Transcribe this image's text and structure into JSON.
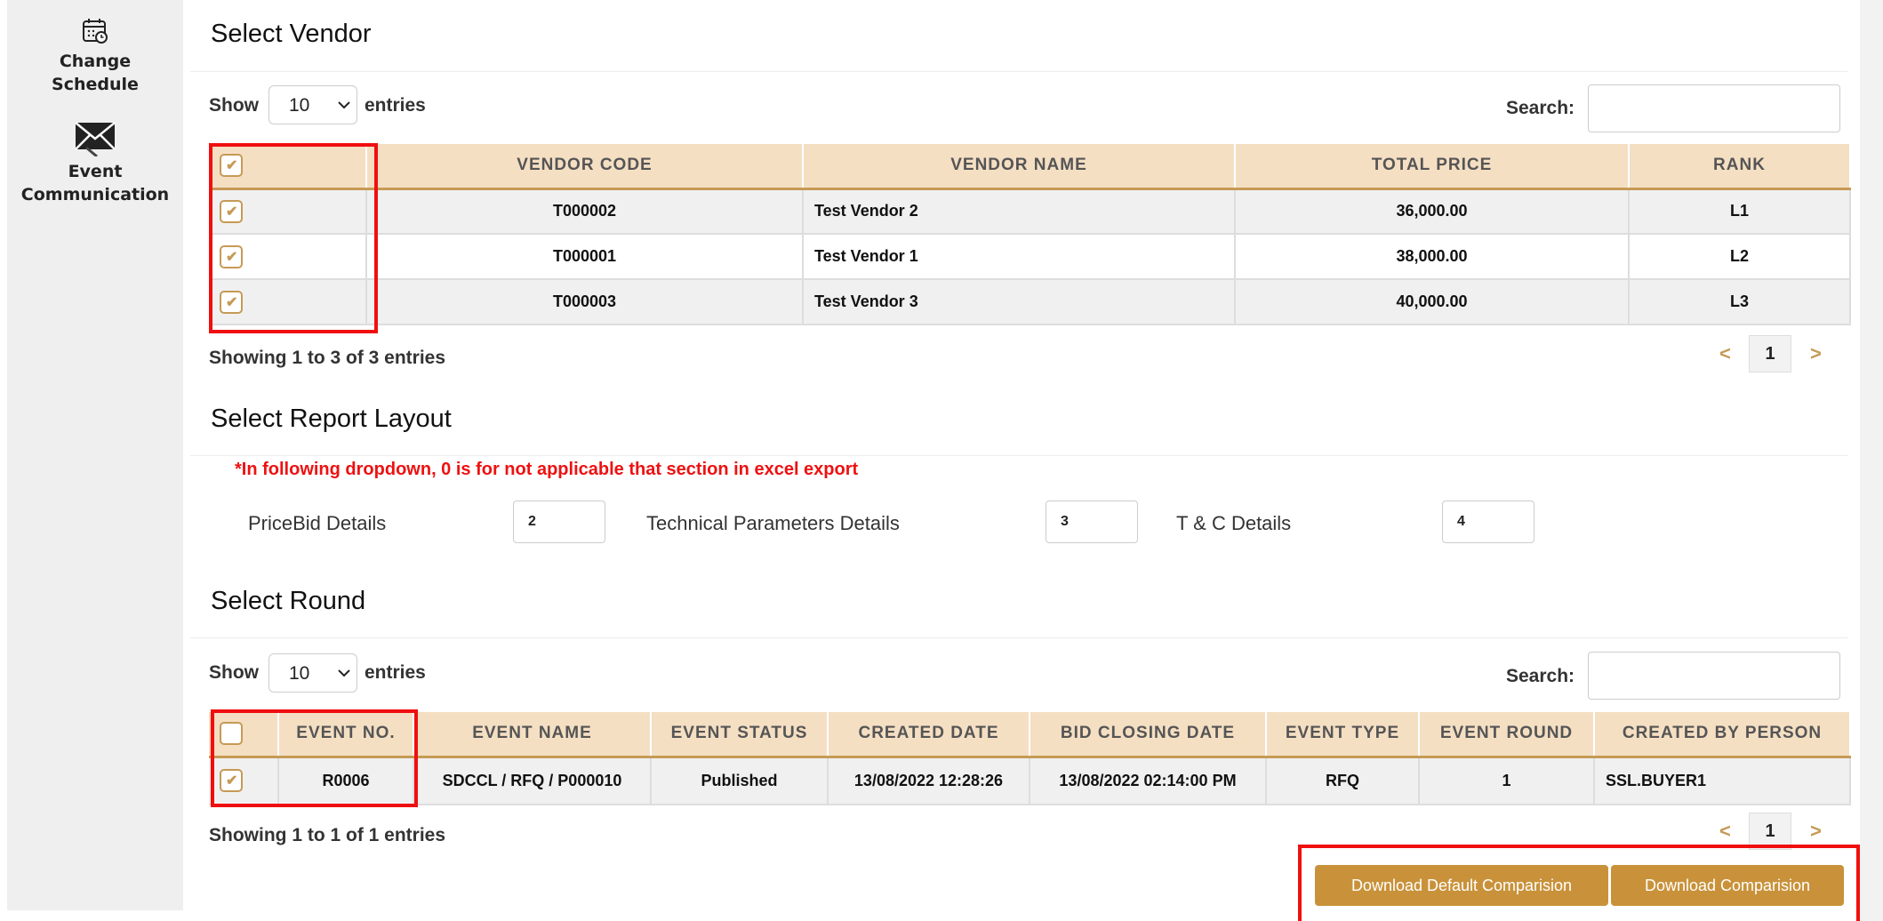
{
  "sidebar": {
    "items": [
      {
        "label": "Change Schedule",
        "icon": "calendar-clock-icon"
      },
      {
        "label": "Event Communication",
        "icon": "envelope-icon"
      }
    ]
  },
  "vendor": {
    "title": "Select Vendor",
    "show_label": "Show",
    "entries_value": "10",
    "entries_label": "entries",
    "search_label": "Search:",
    "search_value": "",
    "columns": [
      "VENDOR CODE",
      "VENDOR NAME",
      "TOTAL PRICE",
      "RANK"
    ],
    "header_checked": true,
    "rows": [
      {
        "code": "T000002",
        "name": "Test Vendor 2",
        "price": "36,000.00",
        "rank": "L1",
        "checked": true
      },
      {
        "code": "T000001",
        "name": "Test Vendor 1",
        "price": "38,000.00",
        "rank": "L2",
        "checked": true
      },
      {
        "code": "T000003",
        "name": "Test Vendor 3",
        "price": "40,000.00",
        "rank": "L3",
        "checked": true
      }
    ],
    "info": "Showing 1 to 3 of 3 entries",
    "pager": {
      "prev": "<",
      "page": "1",
      "next": ">"
    }
  },
  "report": {
    "title": "Select Report Layout",
    "note": "*In following dropdown, 0 is for not applicable that section in excel export",
    "fields": [
      {
        "label": "PriceBid Details",
        "value": "2"
      },
      {
        "label": "Technical Parameters Details",
        "value": "3"
      },
      {
        "label": "T & C Details",
        "value": "4"
      }
    ]
  },
  "round": {
    "title": "Select Round",
    "show_label": "Show",
    "entries_value": "10",
    "entries_label": "entries",
    "search_label": "Search:",
    "search_value": "",
    "columns": [
      "EVENT NO.",
      "EVENT NAME",
      "EVENT STATUS",
      "CREATED DATE",
      "BID CLOSING DATE",
      "EVENT TYPE",
      "EVENT ROUND",
      "CREATED BY PERSON"
    ],
    "header_checked": false,
    "rows": [
      {
        "event_no": "R0006",
        "event_name": "SDCCL / RFQ / P000010",
        "status": "Published",
        "created": "13/08/2022 12:28:26",
        "closing": "13/08/2022 02:14:00 PM",
        "type": "RFQ",
        "round": "1",
        "person": "SSL.BUYER1",
        "checked": true
      }
    ],
    "info": "Showing 1 to 1 of 1 entries",
    "pager": {
      "prev": "<",
      "page": "1",
      "next": ">"
    }
  },
  "buttons": {
    "download_default": "Download Default Comparision",
    "download": "Download Comparision"
  },
  "colors": {
    "accent": "#c9923a",
    "header_bg": "#f5dfc3",
    "highlight": "#f00f0f",
    "note": "#ee1111"
  }
}
